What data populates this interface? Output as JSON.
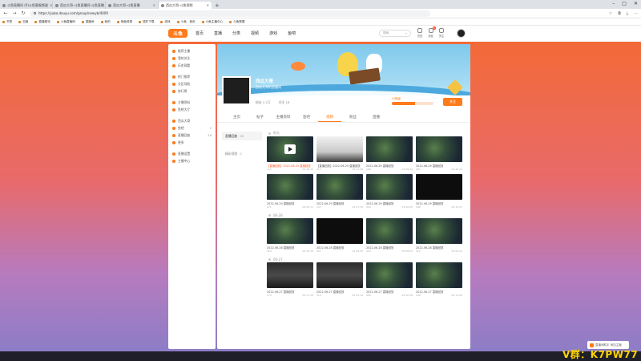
{
  "browser": {
    "tabs": [
      {
        "title": "斗鱼直播间 (0)斗鱼客服频道"
      },
      {
        "title": "西瓜大哥-斗鱼直播间-斗鱼直播"
      },
      {
        "title": "西瓜大哥-斗鱼直播"
      },
      {
        "title": "西瓜大哥-斗鱼视频"
      }
    ],
    "new_tab": "+",
    "url": "https://yuba.douyu.com/group/newyb/4009",
    "bookmarks": [
      "书签",
      "百度",
      "直播推流",
      "斗鱼直播网",
      "直播间",
      "我的",
      "网盘资源",
      "插件下载",
      "游戏",
      "斗鱼 - 首页",
      "斗鱼主播中心",
      "斗鱼数据"
    ]
  },
  "site": {
    "logo": "斗鱼",
    "nav": [
      "首页",
      "直播",
      "分类",
      "视频",
      "游戏",
      "鱼吧"
    ],
    "search_placeholder": "搜索",
    "icons": [
      {
        "label": "历史",
        "badge": ""
      },
      {
        "label": "消息",
        "badge": "2"
      },
      {
        "label": "关注",
        "badge": ""
      }
    ]
  },
  "sidebar": {
    "items": [
      {
        "label": "推荐主播",
        "type": "main"
      },
      {
        "label": "我的关注",
        "type": "main"
      },
      {
        "label": "历史观看",
        "type": "main"
      },
      {
        "gap": true
      },
      {
        "label": "热门推荐",
        "type": "main"
      },
      {
        "label": "分区导航",
        "type": "main"
      },
      {
        "label": "排行榜",
        "type": "main"
      },
      {
        "gap": true
      },
      {
        "label": "主播资料",
        "type": "main"
      },
      {
        "label": "鱼吧大厅",
        "type": "main"
      },
      {
        "gap": true
      },
      {
        "label": "西瓜大哥",
        "type": "sub",
        "count": ""
      },
      {
        "label": "鱼吧",
        "type": "sub",
        "count": "2"
      },
      {
        "label": "直播回放",
        "type": "sub",
        "count": "26"
      },
      {
        "label": "更多",
        "type": "sub",
        "count": ""
      },
      {
        "gap": true
      },
      {
        "label": "直播设置",
        "type": "main"
      },
      {
        "label": "主播中心",
        "type": "main"
      }
    ]
  },
  "profile": {
    "name": "西瓜大哥",
    "subtitle": "西瓜大哥的直播间",
    "stats": [
      "粉丝 1.2万",
      "关注 18"
    ],
    "level_label": "LV等级",
    "level_progress": 0.55,
    "follow_label": "关注"
  },
  "main_tabs": [
    "主页",
    "帖子",
    "主播资料",
    "鱼吧",
    "视频",
    "粉丝",
    "直播"
  ],
  "active_tab_index": 4,
  "filters": [
    {
      "label": "直播回放",
      "count": "26"
    },
    {
      "label": "精彩视频",
      "count": "0"
    }
  ],
  "video_groups": [
    {
      "date": "昨天",
      "rows": [
        [
          {
            "title": "【直播回放】2022-06-29 直播回放",
            "highlight": true,
            "style": "play",
            "views": "132",
            "duration": "02:30:15"
          },
          {
            "title": "【直播回放】2022-06-29 直播回放",
            "highlight": false,
            "style": "desk",
            "views": "213",
            "duration": "03:12:08"
          },
          {
            "title": "2022-06-29 直播回放",
            "highlight": false,
            "style": "game",
            "views": "168",
            "duration": "01:58:40"
          },
          {
            "title": "2022-06-29 直播回放",
            "highlight": false,
            "style": "game",
            "views": "201",
            "duration": "02:44:22"
          }
        ],
        [
          {
            "title": "2022-06-29 直播回放",
            "highlight": false,
            "style": "game",
            "views": "171",
            "duration": "02:05:11"
          },
          {
            "title": "2022-06-29 直播回放",
            "highlight": false,
            "style": "game",
            "views": "127",
            "duration": "01:47:30"
          },
          {
            "title": "2022-06-29 直播回放",
            "highlight": false,
            "style": "game",
            "views": "424",
            "duration": "03:20:05"
          },
          {
            "title": "2022-06-29 直播回放",
            "highlight": false,
            "style": "dark",
            "views": "448",
            "duration": "02:12:47"
          }
        ]
      ]
    },
    {
      "date": "06-28",
      "rows": [
        [
          {
            "title": "2022-06-28 直播回放",
            "highlight": false,
            "style": "game",
            "views": "454",
            "duration": "02:33:19"
          },
          {
            "title": "2022-06-28 直播回放",
            "highlight": false,
            "style": "dark",
            "views": "167",
            "duration": "01:29:55"
          },
          {
            "title": "2022-06-28 直播回放",
            "highlight": false,
            "style": "game",
            "views": "432",
            "duration": "02:58:03"
          },
          {
            "title": "2022-06-28 直播回放",
            "highlight": false,
            "style": "game",
            "views": "472",
            "duration": "03:05:41"
          }
        ]
      ]
    },
    {
      "date": "06-27",
      "rows": [
        [
          {
            "title": "2022-06-27 直播回放",
            "highlight": false,
            "style": "deskdark",
            "views": "373",
            "duration": "02:17:26"
          },
          {
            "title": "2022-06-27 直播回放",
            "highlight": false,
            "style": "deskdark",
            "views": "312",
            "duration": "01:52:14"
          },
          {
            "title": "2022-06-27 直播回放",
            "highlight": false,
            "style": "game",
            "views": "465",
            "duration": "02:40:38"
          },
          {
            "title": "2022-06-27 直播回放",
            "highlight": false,
            "style": "game",
            "views": "398",
            "duration": "03:11:09"
          }
        ]
      ]
    }
  ],
  "promo": "直播间助手 添加主播",
  "overlay": "V群：K7PW77",
  "colors": {
    "accent": "#ff7a1a"
  }
}
